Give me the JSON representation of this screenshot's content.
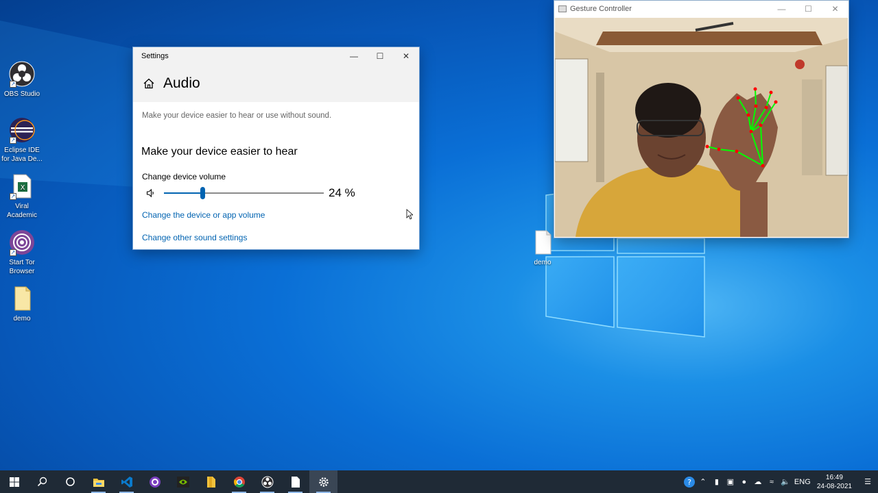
{
  "desktop": {
    "icons": [
      {
        "label": "OBS Studio",
        "icon": "obs-icon"
      },
      {
        "label": "Eclipse IDE for Java De...",
        "icon": "eclipse-icon"
      },
      {
        "label": "Viral Academic",
        "icon": "excel-file-icon"
      },
      {
        "label": "Start Tor Browser",
        "icon": "tor-icon"
      },
      {
        "label": "demo",
        "icon": "folder-icon"
      },
      {
        "label": "demo",
        "icon": "file-icon"
      }
    ]
  },
  "settings": {
    "window_title": "Settings",
    "page_title": "Audio",
    "description": "Make your device easier to hear or use without sound.",
    "section_title": "Make your device easier to hear",
    "volume_label": "Change device volume",
    "volume_value": "24 %",
    "volume_fraction": 0.24,
    "link_device_volume": "Change the device or app volume",
    "link_sound_settings": "Change other sound settings",
    "accent": "#0063b1"
  },
  "gesture": {
    "window_title": "Gesture Controller",
    "landmark_color": "#ff0000",
    "connection_color": "#00ff00"
  },
  "taskbar": {
    "apps": [
      "windows-start-icon",
      "search-icon",
      "cortana-icon",
      "file-explorer-icon",
      "vscode-icon",
      "github-desktop-icon",
      "nvidia-icon",
      "files-icon",
      "chrome-icon",
      "obs-icon",
      "notepad-icon",
      "settings-gear-icon"
    ],
    "language": "ENG",
    "time": "16:49",
    "date": "24-08-2021"
  }
}
